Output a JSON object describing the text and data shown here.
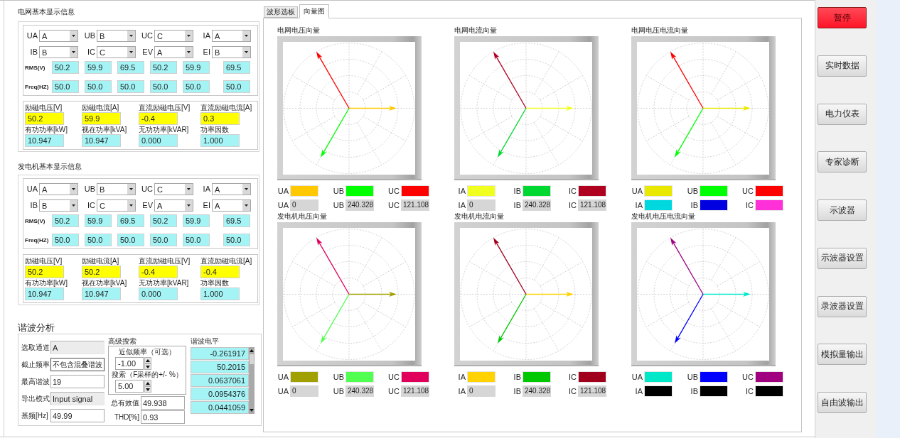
{
  "grid_info": {
    "title": "电网基本显示信息",
    "selectors": [
      {
        "label": "UA",
        "value": "A"
      },
      {
        "label": "UB",
        "value": "B"
      },
      {
        "label": "UC",
        "value": "C"
      },
      {
        "label": "IA",
        "value": "A"
      },
      {
        "label": "IB",
        "value": "B"
      },
      {
        "label": "IC",
        "value": "C"
      },
      {
        "label": "EV",
        "value": "A"
      },
      {
        "label": "EI",
        "value": "B"
      }
    ],
    "rms": {
      "label": "RMS(V)",
      "values": [
        "50.2",
        "59.9",
        "69.5",
        "50.2",
        "59.9",
        "69.5"
      ]
    },
    "freq": {
      "label": "Freq(HZ)",
      "values": [
        "50.0",
        "50.0",
        "50.0",
        "50.0",
        "50.0",
        "50.0"
      ]
    },
    "excitation": [
      {
        "label": "励磁电压[V]",
        "value": "50.2"
      },
      {
        "label": "励磁电流[A]",
        "value": "59.9"
      },
      {
        "label": "直流励磁电压[V]",
        "value": "-0.4"
      },
      {
        "label": "直流励磁电流[A]",
        "value": "0.3"
      }
    ],
    "power": [
      {
        "label": "有功功率[kW]",
        "value": "10.947"
      },
      {
        "label": "视在功率[kVA]",
        "value": "10.947"
      },
      {
        "label": "无功功率[kVAR]",
        "value": "0.000"
      },
      {
        "label": "功率因数",
        "value": "1.000"
      }
    ]
  },
  "generator_info": {
    "title": "发电机基本显示信息",
    "selectors": [
      {
        "label": "UA",
        "value": "A"
      },
      {
        "label": "UB",
        "value": "B"
      },
      {
        "label": "UC",
        "value": "C"
      },
      {
        "label": "IA",
        "value": "A"
      },
      {
        "label": "IB",
        "value": "B"
      },
      {
        "label": "IC",
        "value": "C"
      },
      {
        "label": "EV",
        "value": "A"
      },
      {
        "label": "EI",
        "value": "A"
      }
    ],
    "rms": {
      "label": "RMS(V)",
      "values": [
        "50.2",
        "59.9",
        "69.5",
        "50.2",
        "59.9",
        "69.5"
      ]
    },
    "freq": {
      "label": "Freq(HZ)",
      "values": [
        "50.0",
        "50.0",
        "50.0",
        "50.0",
        "50.0",
        "50.0"
      ]
    },
    "excitation": [
      {
        "label": "励磁电压[V]",
        "value": "50.2"
      },
      {
        "label": "励磁电流[A]",
        "value": "50.2"
      },
      {
        "label": "直流励磁电压[V]",
        "value": "-0.4"
      },
      {
        "label": "直流励磁电流[A]",
        "value": "-0.4"
      }
    ],
    "power": [
      {
        "label": "有功功率[kW]",
        "value": "10.947"
      },
      {
        "label": "视在功率[kVA]",
        "value": "10.947"
      },
      {
        "label": "无功功率[kVAR]",
        "value": "0.000"
      },
      {
        "label": "功率因数",
        "value": "1.000"
      }
    ]
  },
  "harmonics": {
    "title": "谐波分析",
    "fields": [
      {
        "label": "选取通道",
        "value": "A",
        "kind": "indicator"
      },
      {
        "label": "截止频率",
        "value": "不包含混叠谐波",
        "kind": "ring"
      },
      {
        "label": "最高谐波",
        "value": "19",
        "kind": "control"
      },
      {
        "label": "导出模式",
        "value": "Input signal",
        "kind": "indicator"
      },
      {
        "label": "基频[Hz]",
        "value": "49.99",
        "kind": "control"
      }
    ],
    "advanced_search": {
      "title": "高级搜索",
      "approx_frequency": {
        "label": "近似频率（可选）",
        "value": "-1.00"
      },
      "search_range": {
        "label": "搜索（F采样的+/- %）",
        "value": "5.00"
      }
    },
    "totals": [
      {
        "label": "总有效值",
        "value": "49.938"
      },
      {
        "label": "THD[%]",
        "value": "0.93"
      }
    ],
    "levels": {
      "title": "谐波电平",
      "values": [
        "-0.261917",
        "50.2015",
        "0.0637061",
        "0.0954376",
        "0.0441059"
      ]
    }
  },
  "tabs": [
    {
      "label": "波形选板",
      "selected": false
    },
    {
      "label": "向量图",
      "selected": true
    }
  ],
  "charts": [
    {
      "title": "电网电压向量",
      "legend": [
        {
          "kind": "swatch",
          "label": "UA",
          "color": "#ffc800"
        },
        {
          "kind": "swatch",
          "label": "UB",
          "color": "#00ff00"
        },
        {
          "kind": "swatch",
          "label": "UC",
          "color": "#ff0000"
        },
        {
          "kind": "readout",
          "label": "UA",
          "value": "0"
        },
        {
          "kind": "readout",
          "label": "UB",
          "value": "240.328"
        },
        {
          "kind": "readout",
          "label": "UC",
          "value": "121.108"
        }
      ]
    },
    {
      "title": "电网电流向量",
      "legend": [
        {
          "kind": "swatch",
          "label": "IA",
          "color": "#f0ff20"
        },
        {
          "kind": "swatch",
          "label": "IB",
          "color": "#00d832"
        },
        {
          "kind": "swatch",
          "label": "IC",
          "color": "#b00020"
        },
        {
          "kind": "readout",
          "label": "IA",
          "value": "0"
        },
        {
          "kind": "readout",
          "label": "IB",
          "value": "240.328"
        },
        {
          "kind": "readout",
          "label": "IC",
          "value": "121.108"
        }
      ]
    },
    {
      "title": "电网电压电流向量",
      "legend": [
        {
          "kind": "swatch",
          "label": "UA",
          "color": "#e8e800"
        },
        {
          "kind": "swatch",
          "label": "UB",
          "color": "#00ff00"
        },
        {
          "kind": "swatch",
          "label": "UC",
          "color": "#ff0000"
        },
        {
          "kind": "swatch",
          "label": "IA",
          "color": "#00d8e0"
        },
        {
          "kind": "swatch",
          "label": "IB",
          "color": "#0000e0"
        },
        {
          "kind": "swatch",
          "label": "IC",
          "color": "#ff30d8"
        }
      ]
    },
    {
      "title": "发电机电压向量",
      "legend": [
        {
          "kind": "swatch",
          "label": "UA",
          "color": "#a0a000"
        },
        {
          "kind": "swatch",
          "label": "UB",
          "color": "#50ff50"
        },
        {
          "kind": "swatch",
          "label": "UC",
          "color": "#e0005c"
        },
        {
          "kind": "readout",
          "label": "UA",
          "value": "0"
        },
        {
          "kind": "readout",
          "label": "UB",
          "value": "240.328"
        },
        {
          "kind": "readout",
          "label": "UC",
          "value": "121.108"
        }
      ]
    },
    {
      "title": "发电机电流向量",
      "legend": [
        {
          "kind": "swatch",
          "label": "IA",
          "color": "#ffd200"
        },
        {
          "kind": "swatch",
          "label": "IB",
          "color": "#00c800"
        },
        {
          "kind": "swatch",
          "label": "IC",
          "color": "#a0001c"
        },
        {
          "kind": "readout",
          "label": "IA",
          "value": "0"
        },
        {
          "kind": "readout",
          "label": "IB",
          "value": "240.328"
        },
        {
          "kind": "readout",
          "label": "IC",
          "value": "121.108"
        }
      ]
    },
    {
      "title": "发电机电压电流向量",
      "legend": [
        {
          "kind": "swatch",
          "label": "UA",
          "color": "#00e8c8"
        },
        {
          "kind": "swatch",
          "label": "UB",
          "color": "#0000ff"
        },
        {
          "kind": "swatch",
          "label": "UC",
          "color": "#a00080"
        },
        {
          "kind": "swatch",
          "label": "IA",
          "color": "#000000"
        },
        {
          "kind": "swatch",
          "label": "IB",
          "color": "#000000"
        },
        {
          "kind": "swatch",
          "label": "IC",
          "color": "#000000"
        }
      ]
    }
  ],
  "buttons": [
    {
      "label": "暂停",
      "kind": "alert"
    },
    {
      "label": "实时数据",
      "kind": "normal"
    },
    {
      "label": "电力仪表",
      "kind": "normal"
    },
    {
      "label": "专家诊断",
      "kind": "normal"
    },
    {
      "label": "示波器",
      "kind": "normal"
    },
    {
      "label": "示波器设置",
      "kind": "normal"
    },
    {
      "label": "录波器设置",
      "kind": "normal"
    },
    {
      "label": "模拟量输出",
      "kind": "normal"
    },
    {
      "label": "自由波输出",
      "kind": "normal"
    }
  ]
}
